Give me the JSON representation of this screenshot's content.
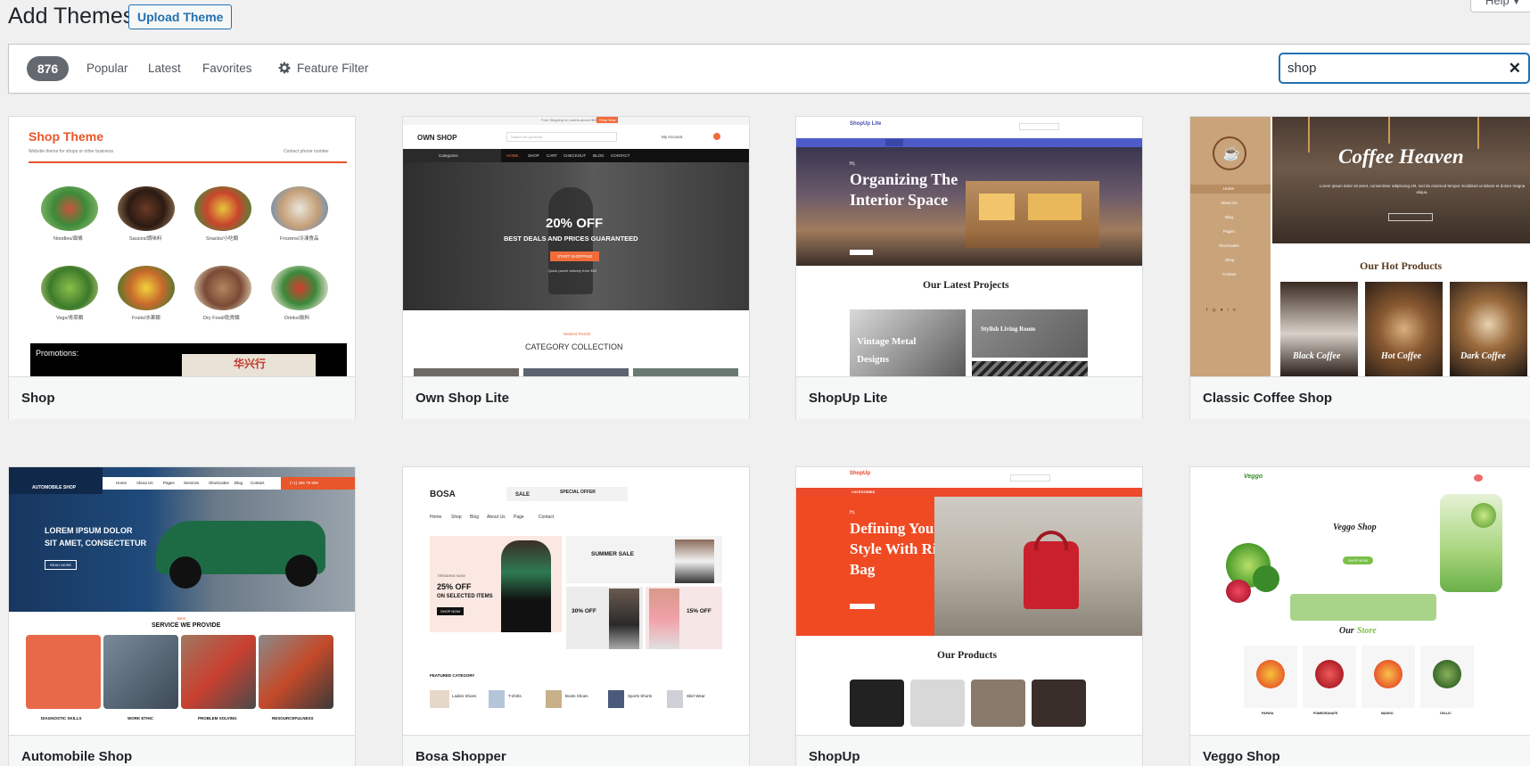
{
  "header": {
    "title": "Add Themes",
    "upload_label": "Upload Theme",
    "help_label": "Help"
  },
  "filters": {
    "count": "876",
    "popular": "Popular",
    "latest": "Latest",
    "favorites": "Favorites",
    "feature_filter": "Feature Filter"
  },
  "search": {
    "value": "shop",
    "clear_icon": "close-icon"
  },
  "themes": [
    {
      "name": "Shop",
      "preview": {
        "title": "Shop Theme",
        "tagline": "Website theme for shops or other business",
        "right": "Contact phone number",
        "products": [
          "Noodles/面條",
          "Sauces/調味料",
          "Snacks/小吃類",
          "Frozens/冷凍食品",
          "Vegs/青菜類",
          "Fruits/水果類",
          "Dry Food/乾貨類",
          "Drinks/飲料"
        ],
        "promo": "Promotions:",
        "sign": "华兴行"
      }
    },
    {
      "name": "Own Shop Lite",
      "preview": {
        "topbar": "Free Shipping on orders above $50",
        "topbar_btn": "Shop Now",
        "logo": "OWN SHOP",
        "search": "Search for products",
        "account": "My Account",
        "categories": "Categories",
        "nav": [
          "HOME",
          "SHOP",
          "CART",
          "CHECKOUT",
          "BLOG",
          "CONTACT"
        ],
        "hero_big": "20% OFF",
        "hero_sub": "BEST DEALS AND PRICES GUARANTEED",
        "hero_btn": "START SHOPPING",
        "hero_note": "Quick parcel delivery from $50",
        "section_small": "Newest Trends",
        "section_title": "CATEGORY COLLECTION"
      }
    },
    {
      "name": "ShopUp Lite",
      "preview": {
        "logo": "ShopUp Lite",
        "hero_hi": "Hi,",
        "hero_title_1": "Organizing The",
        "hero_title_2": "Interior Space",
        "section_title": "Our Latest Projects",
        "card_1_a": "Vintage Metal",
        "card_1_b": "Designs",
        "card_2": "Stylish Living Room"
      }
    },
    {
      "name": "Classic Coffee Shop",
      "preview": {
        "hero_title": "Coffee Heaven",
        "hero_text": "Lorem ipsum dolor sit amet, consectetur adipiscing elit, sed do eiusmod tempor incididunt ut labore et dolore magna aliqua.",
        "menu": [
          "Home",
          "About Us",
          "Blog",
          "Pages",
          "Shortcodes",
          "Shop",
          "Contact"
        ],
        "section_title": "Our Hot Products",
        "products": [
          "Black Coffee",
          "Hot Coffee",
          "Dark Coffee"
        ]
      }
    },
    {
      "name": "Automobile Shop",
      "preview": {
        "logo": "AUTOMOBILE SHOP",
        "nav": [
          "Home",
          "About Us",
          "Pages",
          "Services",
          "Shortcodes",
          "Blog",
          "Contact"
        ],
        "phone": "(+1) 456 78 999",
        "hero_line_1": "LOREM IPSUM DOLOR",
        "hero_line_2": "SIT AMET, CONSECTETUR",
        "hero_btn": "READ MORE",
        "section_small": "Best",
        "section_title": "SERVICE WE PROVIDE",
        "services": [
          "DIAGNOSTIC SKILLS",
          "WORK ETHIC",
          "PROBLEM SOLVING",
          "RESOURCEFULNESS"
        ]
      }
    },
    {
      "name": "Bosa Shopper",
      "preview": {
        "logo": "BOSA",
        "sale": "SALE",
        "special": "SPECIAL OFFER",
        "nav": [
          "Home",
          "Shop",
          "Blog",
          "About Us",
          "Page",
          "Contact"
        ],
        "hero_small": "TRENDING NOW",
        "hero_big_1": "25% OFF",
        "hero_big_2": "ON SELECTED ITEMS",
        "hero_btn": "SHOP NOW",
        "summer": "SUMMER SALE",
        "off_1": "30% OFF",
        "off_2": "15% OFF",
        "featured": "FEATURED CATEGORY",
        "cats": [
          "Ladies Shoes",
          "T-shirts",
          "Boots Shoes",
          "Sports Shorts",
          "Skirt Wear"
        ]
      }
    },
    {
      "name": "ShopUp",
      "preview": {
        "logo": "ShopUp",
        "categories": "CATEGORIES",
        "hero_hi": "Hi,",
        "hero_title_1": "Defining Your",
        "hero_title_2": "Style With Right",
        "hero_title_3": "Bag",
        "section_title": "Our Products"
      }
    },
    {
      "name": "Veggo Shop",
      "preview": {
        "logo": "Veggo",
        "hero_title": "Veggo Shop",
        "hero_btn": "SHOP NOW",
        "section_1": "Our",
        "section_2": "Store",
        "products": [
          "PAPAYA",
          "POMEGRANATE",
          "MANGO",
          "CELLIC"
        ]
      }
    }
  ]
}
